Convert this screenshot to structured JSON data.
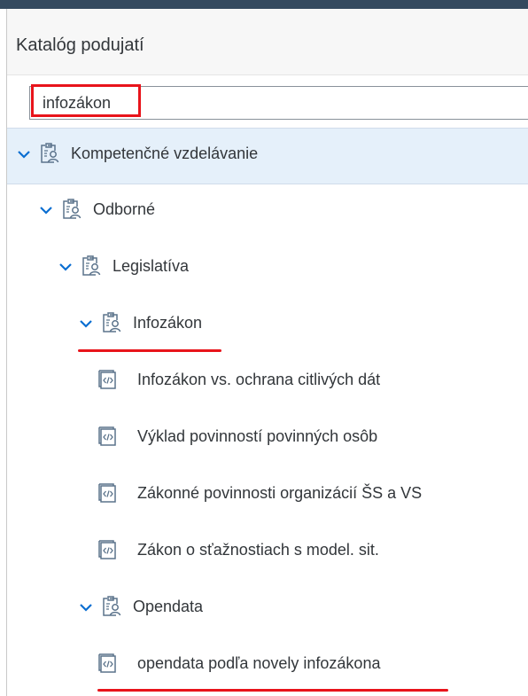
{
  "header": {
    "title": "Katalóg podujatí"
  },
  "search": {
    "value": "infozákon"
  },
  "tree": [
    {
      "label": "Kompetenčné vzdelávanie",
      "type": "folder",
      "level": 0
    },
    {
      "label": "Odborné",
      "type": "folder",
      "level": 1
    },
    {
      "label": "Legislatíva",
      "type": "folder",
      "level": 2
    },
    {
      "label": "Infozákon",
      "type": "folder",
      "level": 3
    },
    {
      "label": "Infozákon vs. ochrana citlivých dát",
      "type": "item",
      "level": 4
    },
    {
      "label": "Výklad povinností povinných osôb",
      "type": "item",
      "level": 4
    },
    {
      "label": "Zákonné povinnosti organizácií ŠS a VS",
      "type": "item",
      "level": 4
    },
    {
      "label": "Zákon o sťažnostiach s model. sit.",
      "type": "item",
      "level": 4
    },
    {
      "label": "Opendata",
      "type": "folder",
      "level": 3
    },
    {
      "label": "opendata podľa novely infozákona",
      "type": "item",
      "level": 4
    }
  ],
  "icons": {
    "folder": "catalog-group-icon",
    "item": "course-item-icon",
    "expand": "chevron-down-icon"
  },
  "colors": {
    "accent": "#0a6ed1",
    "highlight": "#e8141b",
    "selected": "#e5f0fa",
    "topbar": "#354a5f"
  }
}
